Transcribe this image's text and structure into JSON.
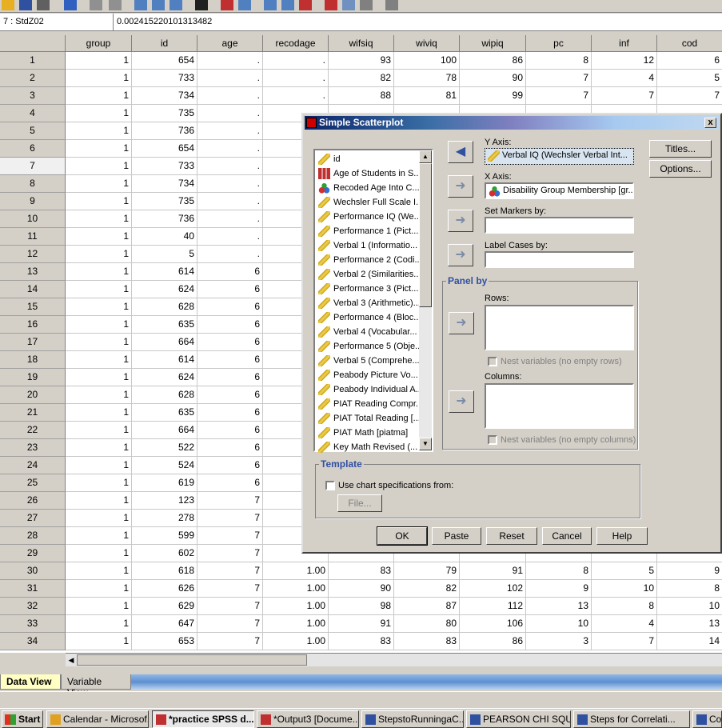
{
  "cell_ref": "7 : StdZ02",
  "cell_value": "0.00241522010131348​2",
  "columns": [
    "group",
    "id",
    "age",
    "recodage",
    "wifsiq",
    "wiviq",
    "wipiq",
    "pc",
    "inf",
    "cod"
  ],
  "rows": [
    [
      "1",
      "1",
      "654",
      ".",
      ".",
      "93",
      "100",
      "86",
      "8",
      "12",
      "6"
    ],
    [
      "2",
      "1",
      "733",
      ".",
      ".",
      "82",
      "78",
      "90",
      "7",
      "4",
      "5"
    ],
    [
      "3",
      "1",
      "734",
      ".",
      ".",
      "88",
      "81",
      "99",
      "7",
      "7",
      "7"
    ],
    [
      "4",
      "1",
      "735",
      ".",
      "",
      "",
      "",
      "",
      "",
      "",
      ""
    ],
    [
      "5",
      "1",
      "736",
      ".",
      "",
      "",
      "",
      "",
      "",
      "",
      ""
    ],
    [
      "6",
      "1",
      "654",
      ".",
      "",
      "",
      "",
      "",
      "",
      "",
      ""
    ],
    [
      "7",
      "1",
      "733",
      ".",
      "",
      "",
      "",
      "",
      "",
      "",
      ""
    ],
    [
      "8",
      "1",
      "734",
      ".",
      "",
      "",
      "",
      "",
      "",
      "",
      ""
    ],
    [
      "9",
      "1",
      "735",
      ".",
      "",
      "",
      "",
      "",
      "",
      "",
      ""
    ],
    [
      "10",
      "1",
      "736",
      ".",
      "",
      "",
      "",
      "",
      "",
      "",
      ""
    ],
    [
      "11",
      "1",
      "40",
      ".",
      "",
      "",
      "",
      "",
      "",
      "",
      ""
    ],
    [
      "12",
      "1",
      "5",
      ".",
      "",
      "",
      "",
      "",
      "",
      "",
      ""
    ],
    [
      "13",
      "1",
      "614",
      "6",
      "",
      "",
      "",
      "",
      "",
      "",
      ""
    ],
    [
      "14",
      "1",
      "624",
      "6",
      "",
      "",
      "",
      "",
      "",
      "",
      ""
    ],
    [
      "15",
      "1",
      "628",
      "6",
      "",
      "",
      "",
      "",
      "",
      "",
      ""
    ],
    [
      "16",
      "1",
      "635",
      "6",
      "",
      "",
      "",
      "",
      "",
      "",
      ""
    ],
    [
      "17",
      "1",
      "664",
      "6",
      "",
      "",
      "",
      "",
      "",
      "",
      ""
    ],
    [
      "18",
      "1",
      "614",
      "6",
      "",
      "",
      "",
      "",
      "",
      "",
      ""
    ],
    [
      "19",
      "1",
      "624",
      "6",
      "",
      "",
      "",
      "",
      "",
      "",
      ""
    ],
    [
      "20",
      "1",
      "628",
      "6",
      "",
      "",
      "",
      "",
      "",
      "",
      ""
    ],
    [
      "21",
      "1",
      "635",
      "6",
      "",
      "",
      "",
      "",
      "",
      "",
      ""
    ],
    [
      "22",
      "1",
      "664",
      "6",
      "",
      "",
      "",
      "",
      "",
      "",
      ""
    ],
    [
      "23",
      "1",
      "522",
      "6",
      "",
      "",
      "",
      "",
      "",
      "",
      ""
    ],
    [
      "24",
      "1",
      "524",
      "6",
      "",
      "",
      "",
      "",
      "",
      "",
      ""
    ],
    [
      "25",
      "1",
      "619",
      "6",
      "",
      "",
      "",
      "",
      "",
      "",
      ""
    ],
    [
      "26",
      "1",
      "123",
      "7",
      "",
      "",
      "",
      "",
      "",
      "",
      ""
    ],
    [
      "27",
      "1",
      "278",
      "7",
      "",
      "",
      "",
      "",
      "",
      "",
      ""
    ],
    [
      "28",
      "1",
      "599",
      "7",
      "",
      "",
      "",
      "",
      "",
      "",
      ""
    ],
    [
      "29",
      "1",
      "602",
      "7",
      "",
      "",
      "",
      "",
      "",
      "",
      ""
    ],
    [
      "30",
      "1",
      "618",
      "7",
      "1.00",
      "83",
      "79",
      "91",
      "8",
      "5",
      "9"
    ],
    [
      "31",
      "1",
      "626",
      "7",
      "1.00",
      "90",
      "82",
      "102",
      "9",
      "10",
      "8"
    ],
    [
      "32",
      "1",
      "629",
      "7",
      "1.00",
      "98",
      "87",
      "112",
      "13",
      "8",
      "10"
    ],
    [
      "33",
      "1",
      "647",
      "7",
      "1.00",
      "91",
      "80",
      "106",
      "10",
      "4",
      "13"
    ],
    [
      "34",
      "1",
      "653",
      "7",
      "1.00",
      "83",
      "83",
      "86",
      "3",
      "7",
      "14"
    ]
  ],
  "selected_row": "7",
  "tabs": {
    "data_view": "Data View",
    "variable_view": "Variable View"
  },
  "dialog": {
    "title": "Simple Scatterplot",
    "variables": [
      {
        "label": "id",
        "icon": "ruler"
      },
      {
        "label": "Age of Students in S...",
        "icon": "ordinal"
      },
      {
        "label": "Recoded Age Into C...",
        "icon": "nominal"
      },
      {
        "label": "Wechsler Full Scale I...",
        "icon": "ruler"
      },
      {
        "label": "Performance IQ (We...",
        "icon": "ruler"
      },
      {
        "label": "Performance 1 (Pict...",
        "icon": "ruler"
      },
      {
        "label": "Verbal 1 (Informatio...",
        "icon": "ruler"
      },
      {
        "label": "Performance 2 (Codi...",
        "icon": "ruler"
      },
      {
        "label": "Verbal 2 (Similarities...",
        "icon": "ruler"
      },
      {
        "label": "Performance 3 (Pict...",
        "icon": "ruler"
      },
      {
        "label": "Verbal 3 (Arithmetic)...",
        "icon": "ruler"
      },
      {
        "label": "Performance 4 (Bloc...",
        "icon": "ruler"
      },
      {
        "label": "Verbal 4 (Vocabular...",
        "icon": "ruler"
      },
      {
        "label": "Performance 5 (Obje...",
        "icon": "ruler"
      },
      {
        "label": "Verbal 5 (Comprehe...",
        "icon": "ruler"
      },
      {
        "label": "Peabody Picture Vo...",
        "icon": "ruler"
      },
      {
        "label": "Peabody Individual A...",
        "icon": "ruler"
      },
      {
        "label": "PIAT Reading Compr...",
        "icon": "ruler"
      },
      {
        "label": "PIAT Total Reading [...",
        "icon": "ruler"
      },
      {
        "label": "PIAT Math [piatma]",
        "icon": "ruler"
      },
      {
        "label": "Key Math Revised (...",
        "icon": "ruler"
      }
    ],
    "y_axis_label": "Y Axis:",
    "y_axis_value": "Verbal IQ (Wechsler Verbal Int...",
    "x_axis_label": "X Axis:",
    "x_axis_value": "Disability Group Membership [gr...",
    "set_markers_label": "Set Markers by:",
    "label_cases_label": "Label Cases by:",
    "panel_by_label": "Panel by",
    "rows_label": "Rows:",
    "columns_label": "Columns:",
    "nest_rows_label": "Nest variables (no empty rows)",
    "nest_cols_label": "Nest variables (no empty columns)",
    "template_label": "Template",
    "use_chart_spec_label": "Use chart specifications from:",
    "file_button": "File...",
    "titles_button": "Titles...",
    "options_button": "Options...",
    "ok_button": "OK",
    "paste_button": "Paste",
    "reset_button": "Reset",
    "cancel_button": "Cancel",
    "help_button": "Help"
  },
  "taskbar": {
    "start": "Start",
    "items": [
      {
        "label": "Calendar - Microsof...",
        "active": false
      },
      {
        "label": "*practice SPSS d...",
        "active": true
      },
      {
        "label": "*Output3 [Docume...",
        "active": false
      },
      {
        "label": "StepstoRunningaC...",
        "active": false
      },
      {
        "label": "PEARSON CHI SQU...",
        "active": false
      },
      {
        "label": "Steps for Correlati...",
        "active": false
      },
      {
        "label": "Correla",
        "active": false
      }
    ]
  }
}
